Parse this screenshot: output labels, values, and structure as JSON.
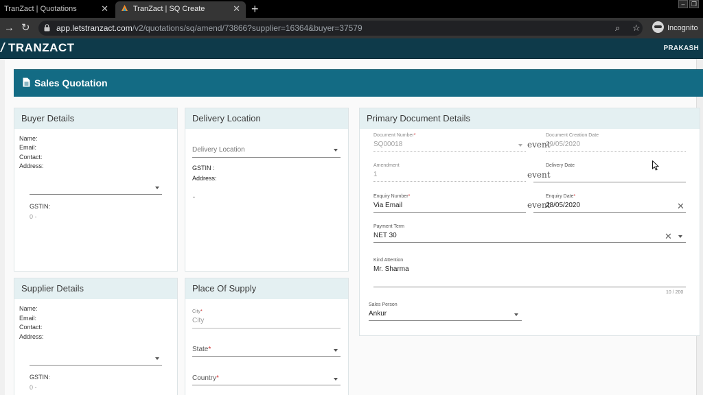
{
  "browser": {
    "tabs": [
      {
        "title": "TranZact | Quotations",
        "active": false
      },
      {
        "title": "TranZact | SQ Create",
        "active": true
      }
    ],
    "new_tab": "+",
    "url_host": "app.letstranzact.com",
    "url_path": "/v2/quotations/sq/amend/73866?supplier=16364&buyer=37579",
    "incognito_label": "Incognito"
  },
  "app": {
    "logo": "TRANZACT",
    "user": "PRAKASH"
  },
  "page_title": "Sales Quotation",
  "buyer": {
    "title": "Buyer Details",
    "name_label": "Name:",
    "email_label": "Email:",
    "contact_label": "Contact:",
    "address_label": "Address:",
    "gstin_label": "GSTIN:",
    "gstin_value": "0 -"
  },
  "delivery": {
    "title": "Delivery Location",
    "select_placeholder": "Delivery Location",
    "gstin_label": "GSTIN :",
    "address_label": "Address:",
    "dash": "-"
  },
  "supplier": {
    "title": "Supplier Details",
    "name_label": "Name:",
    "email_label": "Email:",
    "contact_label": "Contact:",
    "address_label": "Address:",
    "gstin_label": "GSTIN:",
    "gstin_value": "0 -"
  },
  "supply": {
    "title": "Place Of Supply",
    "city_label": "City",
    "city_placeholder": "City",
    "state_label": "State",
    "country_label": "Country",
    "required_mark": "*"
  },
  "primary": {
    "title": "Primary Document Details",
    "doc_number_label": "Document Number",
    "doc_number_value": "SQ00018",
    "creation_date_label": "Document Creation Date",
    "creation_date_value": "29/05/2020",
    "amendment_label": "Amendment",
    "amendment_value": "1",
    "delivery_date_label": "Delivery Date",
    "enquiry_number_label": "Enquiry Number",
    "enquiry_number_value": "Via Email",
    "enquiry_date_label": "Enquiry Date",
    "enquiry_date_value": "28/05/2020",
    "payment_term_label": "Payment Term",
    "payment_term_value": "NET 30",
    "kind_attention_label": "Kind Attention",
    "kind_attention_value": "Mr. Sharma",
    "char_counter": "10 / 200",
    "sales_person_label": "Sales Person",
    "sales_person_value": "Ankur",
    "event_text": "event",
    "required_mark": "*"
  },
  "colors": {
    "header_teal": "#136b84",
    "app_bar": "#0e3a4a",
    "card_head": "#e4f0f2",
    "required": "#d32f2f"
  }
}
